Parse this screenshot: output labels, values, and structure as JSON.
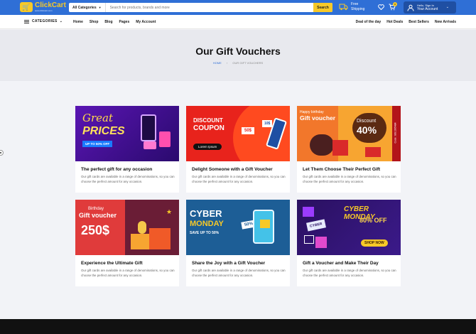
{
  "header": {
    "logo_name": "ClickCart",
    "logo_tagline": "www.clickcart.com",
    "search_category": "All Categories",
    "search_placeholder": "Search for products, brands and more",
    "search_button": "Search",
    "ship_line1": "Free",
    "ship_line2": "Shipping",
    "cart_count": "0",
    "account_line1": "Hello, Sign In",
    "account_line2": "Your Account"
  },
  "nav": {
    "categories_label": "CATEGORIES",
    "links": [
      "Home",
      "Shop",
      "Blog",
      "Pages",
      "My Account"
    ],
    "right_links": [
      "Deal of the day",
      "Hot Deals",
      "Best Sellers",
      "New Arrivals"
    ]
  },
  "hero": {
    "title": "Our Gift Vouchers",
    "breadcrumb_home": "HOME",
    "breadcrumb_current": "OUR GIFT VOUCHERS"
  },
  "cards": [
    {
      "title": "The perfect gift for any occasion",
      "text": "Our gift cards are available in a range of denominations, so you can choose the perfect amount for any occasion.",
      "banner": {
        "line1": "Great",
        "line2": "PRICES",
        "line3": "UP TO 50% OFF"
      }
    },
    {
      "title": "Delight Someone with a Gift Voucher",
      "text": "Our gift cards are available in a range of denominations, so you can choose the perfect amount for any occasion.",
      "banner": {
        "line1": "DISCOUNT",
        "line2": "COUPON",
        "line3": "Lorem Ipsum",
        "tag1": "50$",
        "tag2": "10$"
      }
    },
    {
      "title": "Let Them Choose Their Perfect Gift",
      "text": "Our gift cards are available in a range of denominations, so you can choose the perfect amount for any occasion.",
      "banner": {
        "line1": "Happy birthday",
        "line2": "Gift voucher",
        "line3": "Discount",
        "line4": "40%",
        "code": "Code : BG1395484"
      }
    },
    {
      "title": "Experience the Ultimate Gift",
      "text": "Our gift cards are available in a range of denominations, so you can choose the perfect amount for any occasion.",
      "banner": {
        "line1": "Birthday",
        "line2": "Gift voucher",
        "line3": "250$"
      }
    },
    {
      "title": "Share the Joy with a Gift Voucher",
      "text": "Our gift cards are available in a range of denominations, so you can choose the perfect amount for any occasion.",
      "banner": {
        "line1": "CYBER",
        "line2": "MONDAY",
        "line3": "SAVE UP TO 50%",
        "tag1": "50%"
      }
    },
    {
      "title": "Gift a Voucher and Make Their Day",
      "text": "Our gift cards are available in a range of denominations, so you can choose the perfect amount for any occasion.",
      "banner": {
        "line1": "CYBER MONDAY",
        "line2": "80% OFF",
        "line3": "SHOP NOW",
        "tag1": "CYBER"
      }
    }
  ],
  "colors": {
    "brand_blue": "#2f6fd6",
    "brand_yellow": "#f7c928",
    "page_bg": "#f2f3f7",
    "hero_bg": "#e8e9ee"
  }
}
